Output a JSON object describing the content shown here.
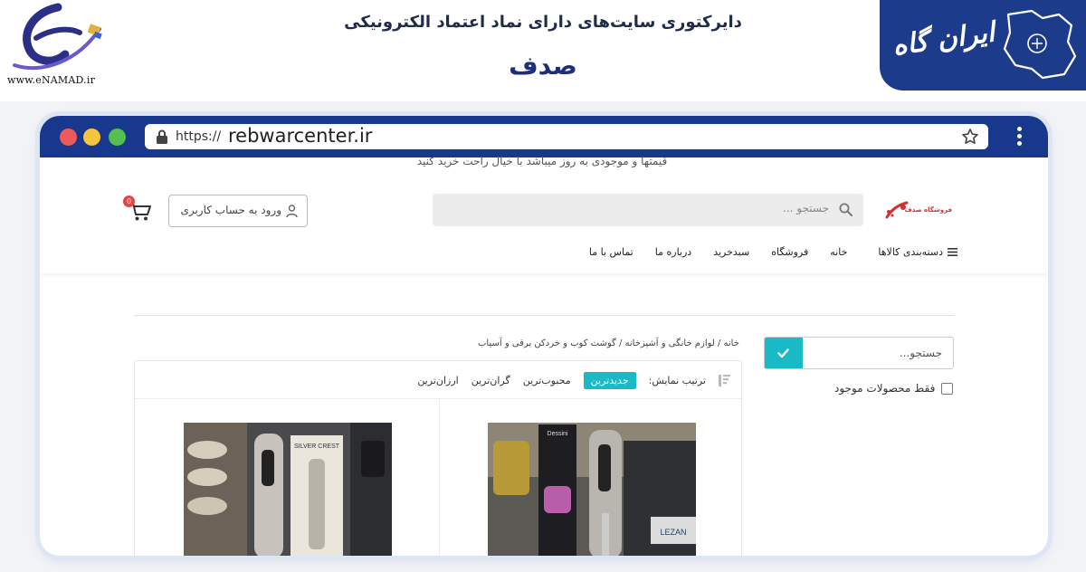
{
  "banner": {
    "heading": "دایرکتوری سایت‌های دارای نماد اعتماد الکترونیکی",
    "site_name": "صدف",
    "enamad_url": "www.eNAMAD.ir",
    "brand_text": "ایران گاه"
  },
  "browser": {
    "url_prefix": "https://",
    "url_host": "rebwarcenter.ir"
  },
  "site": {
    "topbar_text": "قیمتها و موجودی به روز میباشد با خیال راحت خرید کنید",
    "logo_text": "فروشگاه صدف",
    "search_placeholder": "جستجو ...",
    "login_label": "ورود به حساب کاربری",
    "cart_count": "0",
    "nav": {
      "categories": "دسته‌بندی کالاها",
      "items": [
        "خانه",
        "فروشگاه",
        "سبدخرید",
        "درباره ما",
        "تماس با ما"
      ]
    },
    "sidebar": {
      "search_placeholder": "جستجو...",
      "in_stock_label": "فقط محصولات موجود"
    },
    "breadcrumb": "خانه / لوازم خانگی و آشپزخانه / گوشت کوب و خردکن برقی و آسیاب",
    "sort": {
      "label": "ترتیب نمایش:",
      "options": [
        "جدیدترین",
        "محبوب‌ترین",
        "گران‌ترین",
        "ارزان‌ترین"
      ],
      "active_index": 0
    },
    "product_images": {
      "right_brand": "Dessini",
      "left_brand": "SILVER CREST",
      "right_box_label": "LEZAN"
    }
  },
  "colors": {
    "browser_bar": "#17388c",
    "accent": "#19b9c6",
    "brand_blue": "#1c3c8b",
    "cart_badge": "#e44545"
  }
}
